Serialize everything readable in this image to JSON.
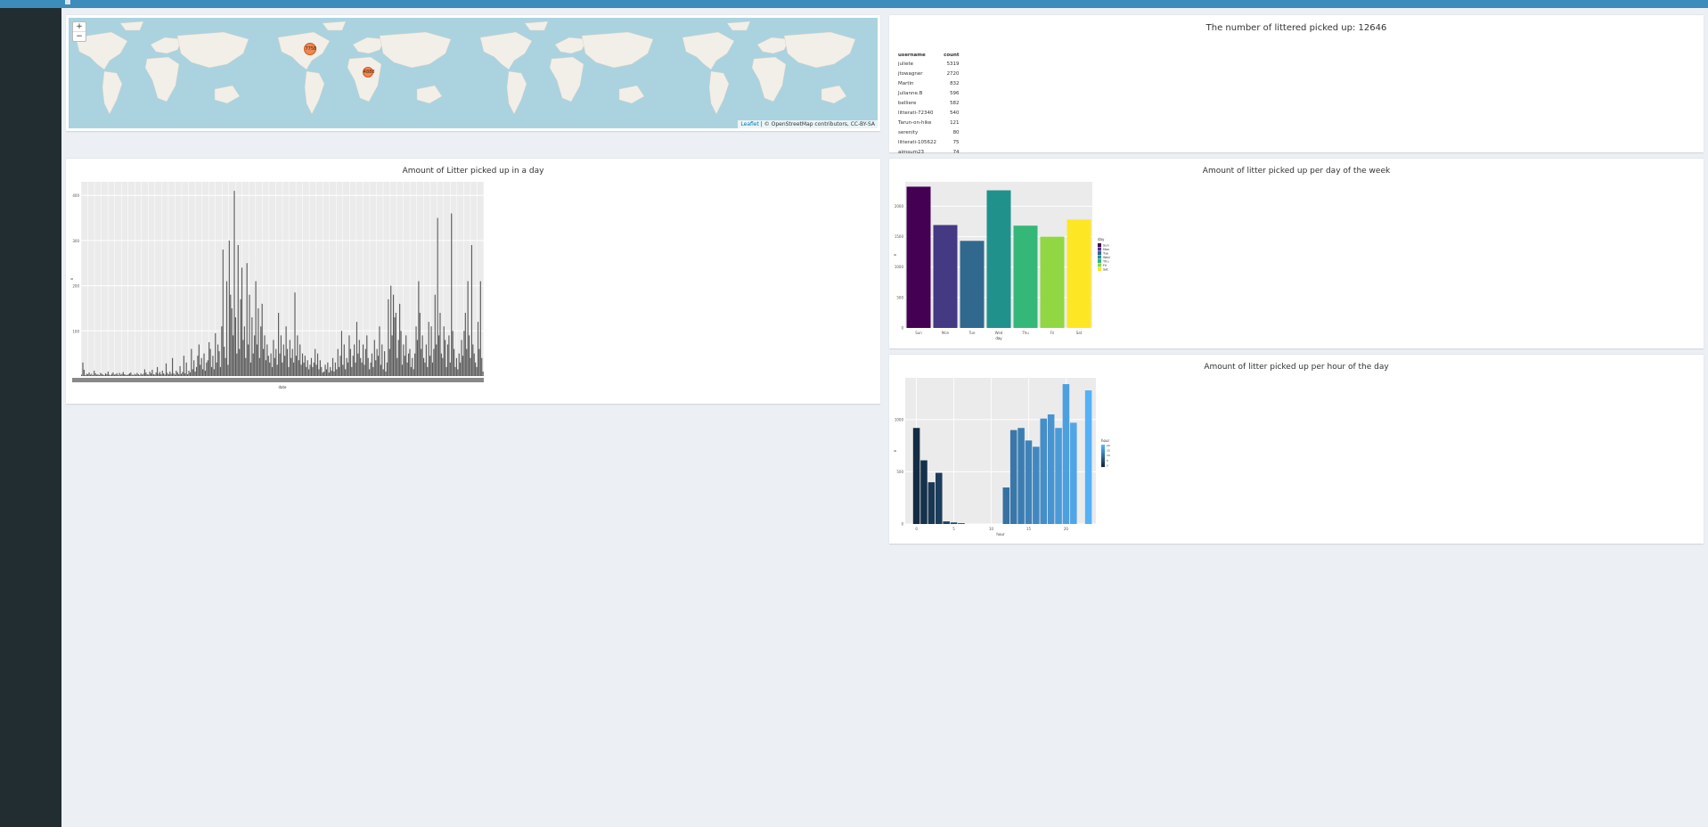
{
  "colors": {
    "header": "#3c8dbc",
    "sidebar": "#222d32",
    "content_bg": "#ecf0f5",
    "map_water": "#aad3df",
    "map_land": "#f2efe9",
    "marker": "#e8773c"
  },
  "header": {
    "toggle_icon": "menu-icon"
  },
  "map": {
    "zoom_in": "+",
    "zoom_out": "−",
    "attribution_leaflet": "Leaflet",
    "attribution_rest": "| © OpenStreetMap contributors, CC-BY-SA",
    "markers": [
      {
        "label": "7758",
        "lat": 40,
        "lng": -92
      },
      {
        "label": "4888",
        "lat": 3,
        "lng": 10
      }
    ]
  },
  "summary": {
    "title": "The number of littered picked up: 12646",
    "columns": [
      "username",
      "count"
    ],
    "rows": [
      [
        "juliete",
        "5319"
      ],
      [
        "jtowagner",
        "2720"
      ],
      [
        "Martin",
        "832"
      ],
      [
        "Julianne.B",
        "596"
      ],
      [
        "belliere",
        "582"
      ],
      [
        "litterati-72340",
        "540"
      ],
      [
        "Tarun-on-hike",
        "121"
      ],
      [
        "serenity",
        "80"
      ],
      [
        "litterati-105622",
        "75"
      ],
      [
        "aimsum23",
        "74"
      ]
    ]
  },
  "charts": {
    "daily": {
      "title": "Amount of Litter picked up in a day",
      "xlabel": "date",
      "ylabel": "n",
      "ytick_labels": [
        "100",
        "200",
        "300",
        "400"
      ],
      "chart_data": {
        "type": "bar",
        "title": "Amount of Litter picked up in a day",
        "xlabel": "date",
        "ylabel": "n",
        "ylim": [
          0,
          430
        ],
        "note": "approximately 330 daily bars; values estimated from visible heights",
        "values": [
          3,
          30,
          14,
          2,
          5,
          4,
          8,
          3,
          5,
          2,
          12,
          6,
          3,
          4,
          2,
          7,
          5,
          3,
          2,
          6,
          4,
          10,
          3,
          2,
          5,
          8,
          3,
          4,
          6,
          2,
          7,
          3,
          5,
          9,
          4,
          3,
          2,
          4,
          6,
          8,
          3,
          2,
          5,
          3,
          7,
          4,
          2,
          6,
          3,
          5,
          15,
          8,
          4,
          3,
          10,
          6,
          14,
          4,
          3,
          8,
          20,
          5,
          9,
          4,
          12,
          6,
          3,
          28,
          7,
          4,
          10,
          5,
          40,
          6,
          3,
          12,
          8,
          4,
          22,
          5,
          9,
          45,
          6,
          30,
          4,
          12,
          8,
          60,
          15,
          35,
          10,
          20,
          45,
          70,
          25,
          40,
          15,
          50,
          12,
          30,
          35,
          75,
          60,
          20,
          45,
          15,
          95,
          30,
          70,
          55,
          20,
          110,
          280,
          65,
          40,
          210,
          25,
          300,
          180,
          150,
          90,
          410,
          130,
          50,
          290,
          60,
          170,
          240,
          80,
          110,
          40,
          250,
          70,
          180,
          30,
          130,
          50,
          90,
          210,
          70,
          150,
          40,
          110,
          160,
          60,
          90,
          35,
          70,
          45,
          30,
          50,
          20,
          80,
          40,
          60,
          25,
          140,
          50,
          90,
          30,
          70,
          45,
          110,
          60,
          20,
          80,
          40,
          60,
          30,
          185,
          45,
          90,
          35,
          70,
          25,
          50,
          30,
          45,
          20,
          35,
          15,
          25,
          40,
          20,
          30,
          60,
          25,
          50,
          15,
          35,
          20,
          8,
          10,
          25,
          15,
          30,
          8,
          20,
          12,
          40,
          10,
          30,
          15,
          60,
          20,
          45,
          100,
          25,
          70,
          15,
          40,
          30,
          90,
          60,
          20,
          45,
          70,
          30,
          120,
          50,
          80,
          40,
          30,
          70,
          25,
          60,
          90,
          40,
          15,
          30,
          50,
          20,
          80,
          35,
          60,
          45,
          110,
          25,
          70,
          15,
          55,
          10,
          30,
          170,
          60,
          200,
          90,
          180,
          130,
          140,
          40,
          80,
          160,
          100,
          25,
          70,
          45,
          90,
          30,
          50,
          60,
          20,
          40,
          15,
          50,
          110,
          80,
          210,
          140,
          60,
          90,
          40,
          30,
          70,
          20,
          120,
          45,
          110,
          30,
          60,
          180,
          70,
          350,
          90,
          140,
          50,
          40,
          110,
          80,
          20,
          70,
          90,
          30,
          360,
          100,
          60,
          20,
          40,
          15,
          50,
          30,
          80,
          45,
          100,
          140,
          60,
          210,
          90,
          40,
          290,
          70,
          50,
          30,
          20,
          120,
          60,
          210,
          40,
          10
        ]
      }
    },
    "weekday": {
      "title": "Amount of litter picked up per day of the week",
      "xlabel": "day",
      "ylabel": "n",
      "legend_title": "day",
      "chart_data": {
        "type": "bar",
        "title": "Amount of litter picked up per day of the week",
        "xlabel": "day",
        "ylabel": "n",
        "ylim": [
          0,
          2400
        ],
        "categories": [
          "Sun",
          "Mon",
          "Tue",
          "Wed",
          "Thu",
          "Fri",
          "Sat"
        ],
        "values": [
          2320,
          1690,
          1430,
          2260,
          1680,
          1500,
          1780
        ],
        "yticks": [
          0,
          500,
          1000,
          1500,
          2000
        ],
        "colors": [
          "#440154",
          "#443983",
          "#31688e",
          "#21918c",
          "#35b779",
          "#90d743",
          "#fde725"
        ],
        "legend": "right"
      }
    },
    "hourly": {
      "title": "Amount of litter picked up per hour of the day",
      "xlabel": "hour",
      "ylabel": "n",
      "legend_title": "hour",
      "chart_data": {
        "type": "bar",
        "title": "Amount of litter picked up per hour of the day",
        "xlabel": "hour",
        "ylabel": "n",
        "ylim": [
          0,
          1400
        ],
        "x": [
          0,
          1,
          2,
          3,
          4,
          5,
          6,
          7,
          8,
          9,
          10,
          11,
          12,
          13,
          14,
          15,
          16,
          17,
          18,
          19,
          20,
          21,
          22,
          23
        ],
        "values": [
          920,
          610,
          400,
          490,
          25,
          15,
          8,
          0,
          0,
          0,
          0,
          0,
          350,
          900,
          920,
          800,
          740,
          1010,
          1050,
          920,
          1340,
          970,
          0,
          1280
        ],
        "yticks": [
          0,
          500,
          1000
        ],
        "xticks": [
          0,
          5,
          10,
          15,
          20
        ],
        "color_low": "#132b43",
        "color_high": "#56b1f7",
        "legend": "right"
      }
    }
  }
}
